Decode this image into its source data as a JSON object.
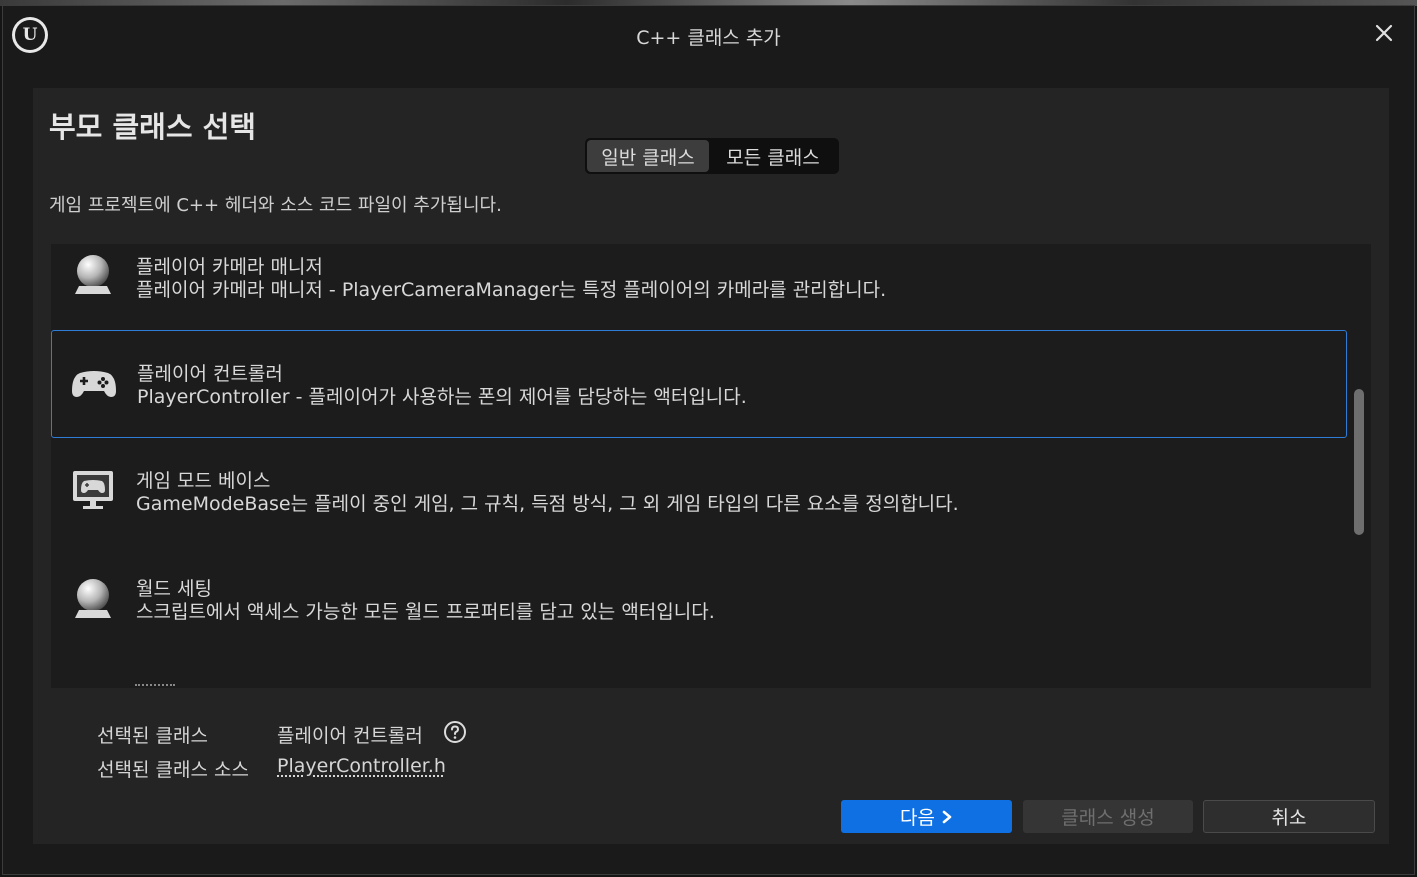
{
  "window": {
    "title": "C++ 클래스 추가"
  },
  "panel": {
    "heading": "부모 클래스 선택",
    "description": "게임 프로젝트에 C++ 헤더와 소스 코드 파일이 추가됩니다.",
    "tabs": [
      {
        "label": "일반 클래스",
        "active": true
      },
      {
        "label": "모든 클래스",
        "active": false
      }
    ]
  },
  "class_list": {
    "items": [
      {
        "title": "플레이어 카메라 매니저",
        "description": "플레이어 카메라 매니저 - PlayerCameraManager는 특정 플레이어의 카메라를 관리합니다.",
        "icon": "sphere-icon"
      },
      {
        "title": "플레이어 컨트롤러",
        "description": "PlayerController - 플레이어가 사용하는 폰의 제어를 담당하는 액터입니다.",
        "icon": "gamepad-icon",
        "selected": true
      },
      {
        "title": "게임 모드 베이스",
        "description": "GameModeBase는 플레이 중인 게임, 그 규칙, 득점 방식, 그 외 게임 타입의 다른 요소를 정의합니다.",
        "icon": "monitor-gamepad-icon"
      },
      {
        "title": "월드 세팅",
        "description": "스크립트에서 액세스 가능한 모든 월드 프로퍼티를 담고 있는 액터입니다.",
        "icon": "sphere-icon"
      }
    ]
  },
  "selection": {
    "class_label": "선택된 클래스",
    "class_value": "플레이어 컨트롤러",
    "source_label": "선택된 클래스 소스",
    "source_value": "PlayerController.h"
  },
  "buttons": {
    "next": "다음",
    "create": "클래스 생성",
    "cancel": "취소"
  },
  "colors": {
    "accent": "#0e70e3",
    "selection_border": "#2f7dd6",
    "panel_bg": "#242424"
  }
}
